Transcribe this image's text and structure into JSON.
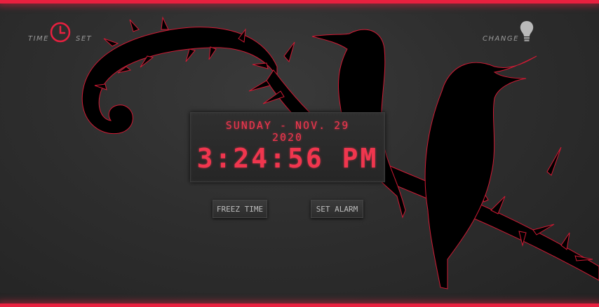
{
  "header": {
    "time_label": "TIME",
    "set_label": "SET",
    "change_label": "CHANGE"
  },
  "clock": {
    "date": "SUNDAY - NOV. 29",
    "year": "2020",
    "time": "3:24:56 PM"
  },
  "controls": {
    "freeze_label": "FREEZ TIME",
    "alarm_label": "SET ALARM"
  },
  "icons": {
    "clock": "clock-icon",
    "bulb": "lightbulb-icon"
  },
  "colors": {
    "accent": "#e8203f",
    "digital": "#f0364e",
    "background": "#2e2e2e",
    "silhouette": "#000000"
  }
}
